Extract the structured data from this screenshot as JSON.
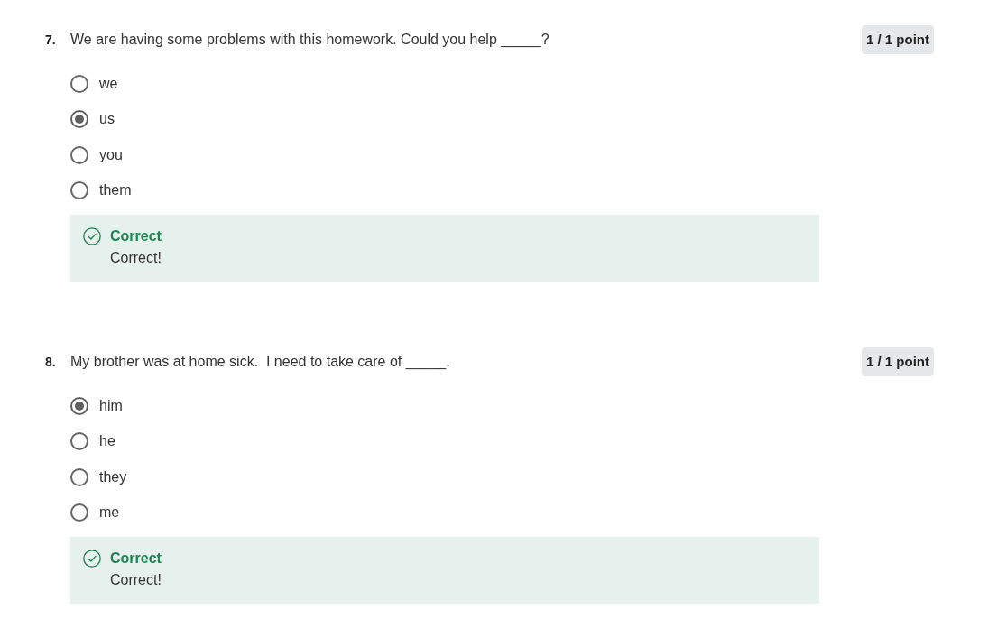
{
  "questions": [
    {
      "number": "7.",
      "text": "We are having some problems with this homework. Could you help _____?",
      "points": "1 / 1 point",
      "options": [
        {
          "label": "we",
          "selected": false
        },
        {
          "label": "us",
          "selected": true
        },
        {
          "label": "you",
          "selected": false
        },
        {
          "label": "them",
          "selected": false
        }
      ],
      "feedback": {
        "kind": "correct",
        "title": "Correct",
        "message": "Correct!"
      }
    },
    {
      "number": "8.",
      "text": "My brother was at home sick.  I need to take care of _____.",
      "points": "1 / 1 point",
      "options": [
        {
          "label": "him",
          "selected": true
        },
        {
          "label": "he",
          "selected": false
        },
        {
          "label": "they",
          "selected": false
        },
        {
          "label": "me",
          "selected": false
        }
      ],
      "feedback": {
        "kind": "correct",
        "title": "Correct",
        "message": "Correct!"
      }
    }
  ]
}
